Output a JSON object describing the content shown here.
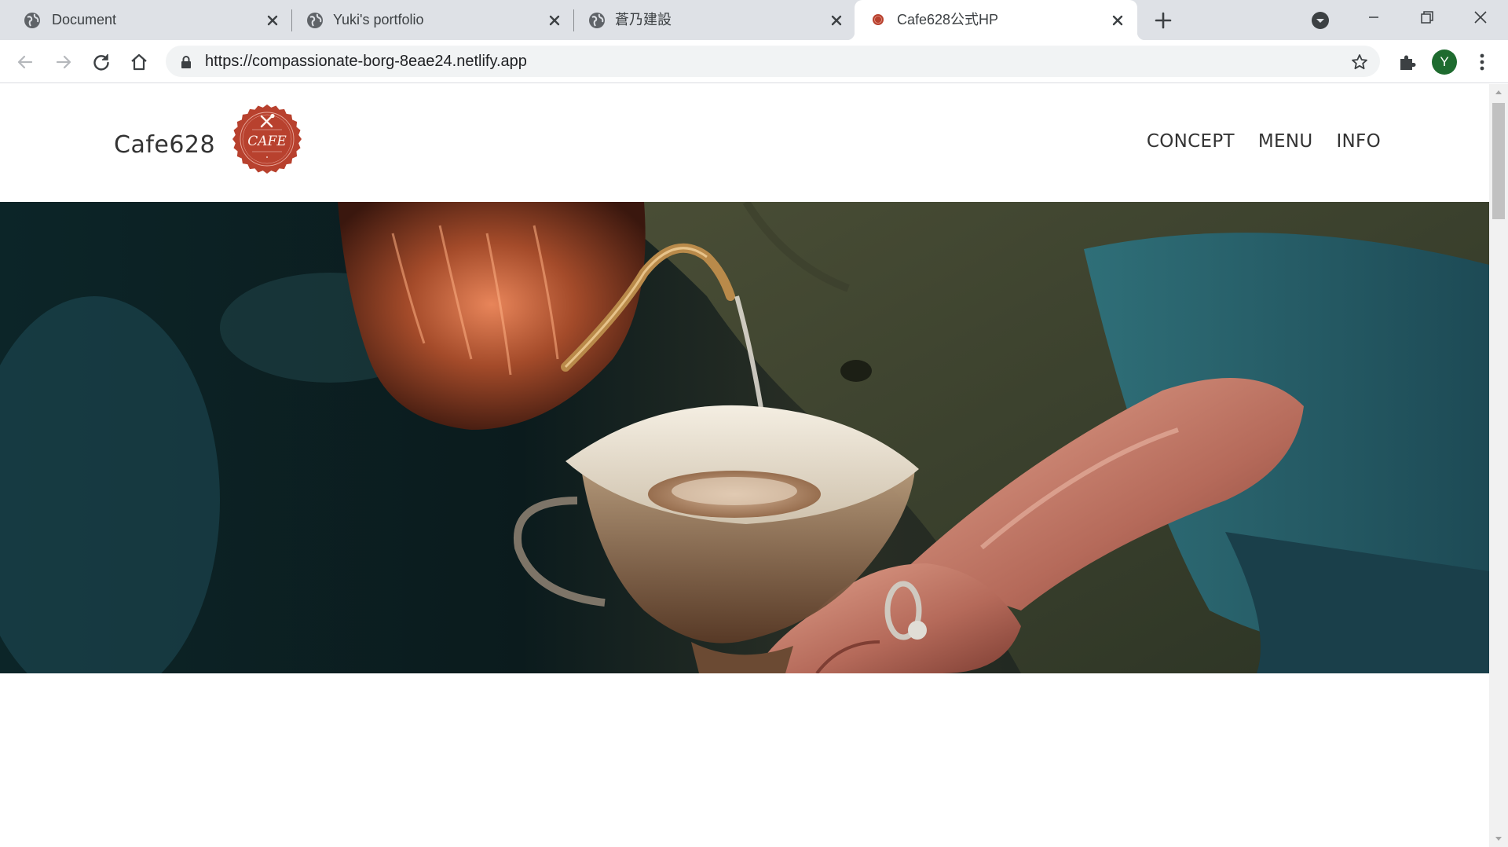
{
  "browser": {
    "tabs": [
      {
        "title": "Document",
        "favicon": "globe-icon",
        "active": false
      },
      {
        "title": "Yuki's portfolio",
        "favicon": "globe-icon",
        "active": false
      },
      {
        "title": "蒼乃建設",
        "favicon": "globe-icon",
        "active": false
      },
      {
        "title": "Cafe628公式HP",
        "favicon": "cafe-logo-icon",
        "active": true
      }
    ],
    "url": "https://compassionate-borg-8eae24.netlify.app",
    "profile_initial": "Y",
    "profile_color": "#1e6b2f"
  },
  "site": {
    "brand": "Cafe628",
    "logo": {
      "text": "CAFE",
      "color": "#b8412e"
    },
    "nav": [
      "CONCEPT",
      "MENU",
      "INFO"
    ],
    "carousel": {
      "slide_count": 1,
      "active_index": 0,
      "indicator_color": "#0d6efd"
    }
  }
}
